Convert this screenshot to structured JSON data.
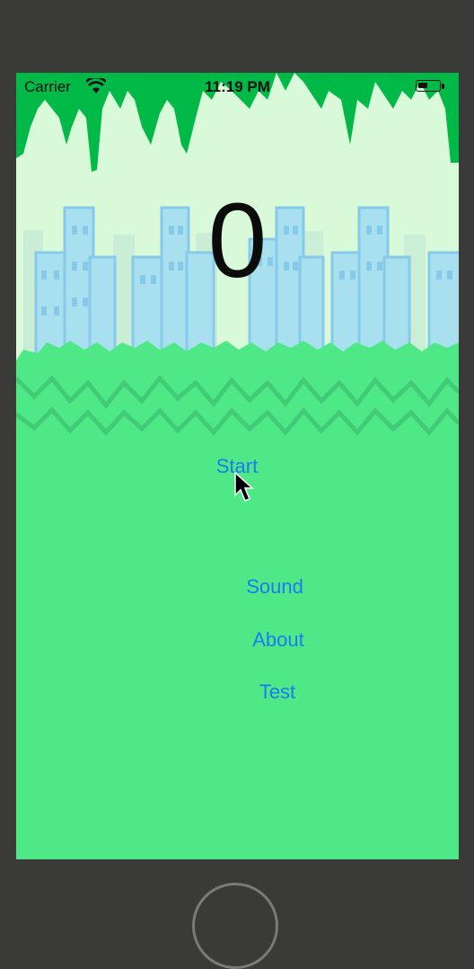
{
  "status_bar": {
    "carrier": "Carrier",
    "time": "11:19 PM",
    "wifi_icon": "wifi-icon",
    "battery_icon": "battery-icon"
  },
  "game": {
    "score": "0"
  },
  "menu": {
    "start_label": "Start",
    "sound_label": "Sound",
    "about_label": "About",
    "test_label": "Test"
  },
  "device": {
    "home_button_icon": "home-button-icon"
  },
  "colors": {
    "bezel": "#3a3a38",
    "sky": "#d9fad8",
    "grass": "#4fe887",
    "vine": "#00b946",
    "building": "#86c9e8",
    "button_text": "#1a7bf2"
  }
}
